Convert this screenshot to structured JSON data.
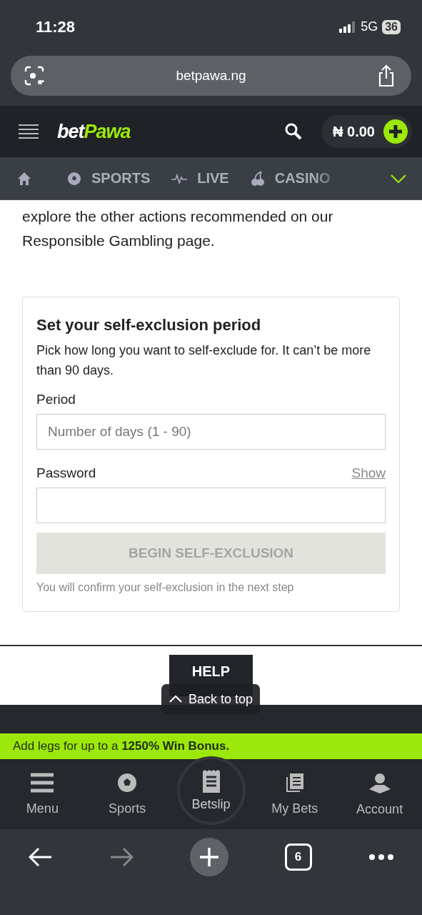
{
  "status_bar": {
    "time": "11:28",
    "network": "5G",
    "battery": "36"
  },
  "browser_bar": {
    "url": "betpawa.ng"
  },
  "header": {
    "logo_left": "bet",
    "logo_right": "Pawa",
    "balance": "₦ 0.00"
  },
  "nav": [
    {
      "label": "SPORTS",
      "kind": "sports"
    },
    {
      "label": "LIVE",
      "kind": "live"
    },
    {
      "label": "CASINO",
      "kind": "casino"
    }
  ],
  "intro": "explore the other actions recommended on our Responsible Gambling page.",
  "form": {
    "title": "Set your self-exclusion period",
    "description": "Pick how long you want to self-exclude for. It can’t be more than 90 days.",
    "period_label": "Period",
    "period_placeholder": "Number of days (1 - 90)",
    "password_label": "Password",
    "show_link": "Show",
    "button": {
      "label": "BEGIN SELF-EXCLUSION",
      "disabled": true
    },
    "note": "You will confirm your self-exclusion in the next step"
  },
  "help": {
    "label": "HELP",
    "back_to_top": "Back to top"
  },
  "banner": "Add legs for up to a **1250% Win Bonus.**",
  "bottom_nav": [
    {
      "label": "Menu",
      "kind": "menu",
      "selected": false
    },
    {
      "label": "Sports",
      "kind": "sports",
      "selected": false
    },
    {
      "label": "Betslip",
      "kind": "betslip",
      "selected": true
    },
    {
      "label": "My Bets",
      "kind": "mybets",
      "selected": false
    },
    {
      "label": "Account",
      "kind": "account",
      "selected": false
    }
  ],
  "browser_toolbar": {
    "back_disabled": false,
    "forward_disabled": true,
    "tab_count": "6"
  }
}
